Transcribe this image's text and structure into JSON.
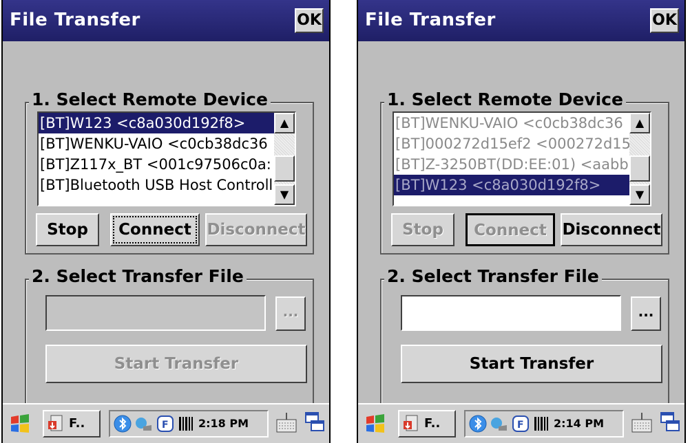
{
  "left_screen": {
    "title": "File Transfer",
    "ok_label": "OK",
    "group1_legend": "1. Select Remote Device",
    "devices": [
      "[BT]W123 <c8a030d192f8>",
      "[BT]WENKU-VAIO <c0cb38dc36",
      "[BT]Z117x_BT <001c97506c0a:",
      "[BT]Bluetooth USB Host Controll"
    ],
    "selected_device_index": 0,
    "stop_label": "Stop",
    "connect_label": "Connect",
    "disconnect_label": "Disconnect",
    "group2_legend": "2. Select Transfer File",
    "file_value": "",
    "browse_label": "...",
    "start_label": "Start Transfer",
    "taskbar_app": "F..",
    "clock": "2:18 PM"
  },
  "right_screen": {
    "title": "File Transfer",
    "ok_label": "OK",
    "group1_legend": "1. Select Remote Device",
    "devices": [
      "[BT]WENKU-VAIO <c0cb38dc36",
      "[BT]000272d15ef2 <000272d15",
      "[BT]Z-3250BT(DD:EE:01) <aabb",
      "[BT]W123 <c8a030d192f8>"
    ],
    "selected_device_index": 3,
    "stop_label": "Stop",
    "connect_label": "Connect",
    "disconnect_label": "Disconnect",
    "group2_legend": "2. Select Transfer File",
    "file_value": "",
    "browse_label": "...",
    "start_label": "Start Transfer",
    "taskbar_app": "F..",
    "clock": "2:14 PM"
  },
  "icons": {
    "start": "windows-flag-icon",
    "app": "file-transfer-app-icon",
    "tray": [
      "bluetooth-icon",
      "network-icon",
      "function-key-icon",
      "barcode-icon"
    ],
    "keyboard": "keyboard-icon",
    "desktop": "windows-switch-icon"
  },
  "colors": {
    "titlebar": "#2a2a7a",
    "selection": "#1c1c6a",
    "dialog_bg": "#bdbdbd"
  }
}
